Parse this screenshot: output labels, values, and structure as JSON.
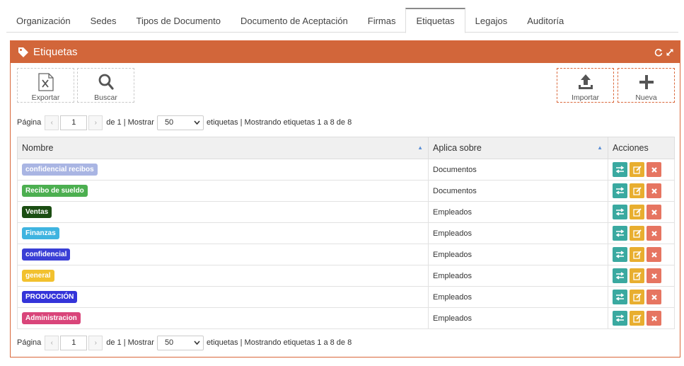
{
  "tabs": [
    {
      "label": "Organización",
      "active": false
    },
    {
      "label": "Sedes",
      "active": false
    },
    {
      "label": "Tipos de Documento",
      "active": false
    },
    {
      "label": "Documento de Aceptación",
      "active": false
    },
    {
      "label": "Firmas",
      "active": false
    },
    {
      "label": "Etiquetas",
      "active": true
    },
    {
      "label": "Legajos",
      "active": false
    },
    {
      "label": "Auditoría",
      "active": false
    }
  ],
  "panel": {
    "title": "Etiquetas",
    "title_icon": "tag-icon",
    "header_icons": [
      "refresh-icon",
      "expand-icon"
    ],
    "accent_color": "#d2663a"
  },
  "toolbar": {
    "export_label": "Exportar",
    "search_label": "Buscar",
    "import_label": "Importar",
    "new_label": "Nueva"
  },
  "pager": {
    "page_label": "Página",
    "page_value": "1",
    "of_text": "de 1 | Mostrar",
    "page_size": "50",
    "summary": "etiquetas | Mostrando etiquetas 1 a 8 de 8",
    "prev_glyph": "‹",
    "next_glyph": "›"
  },
  "table": {
    "columns": [
      "Nombre",
      "Aplica sobre",
      "Acciones"
    ],
    "rows": [
      {
        "name": "confidencial recibos",
        "color": "#a9b5e3",
        "applies": "Documentos"
      },
      {
        "name": "Recibo de sueldo",
        "color": "#4caf50",
        "applies": "Documentos"
      },
      {
        "name": "Ventas",
        "color": "#1b4d12",
        "applies": "Empleados"
      },
      {
        "name": "Finanzas",
        "color": "#3fb4e0",
        "applies": "Empleados"
      },
      {
        "name": "confidencial",
        "color": "#3a3fd6",
        "applies": "Empleados"
      },
      {
        "name": "general",
        "color": "#f2c12e",
        "applies": "Empleados"
      },
      {
        "name": "PRODUCCIÓN",
        "color": "#3434d9",
        "applies": "Empleados"
      },
      {
        "name": "Administracion",
        "color": "#d9457a",
        "applies": "Empleados"
      }
    ],
    "row_actions": [
      "transfer-icon",
      "edit-icon",
      "delete-icon"
    ]
  },
  "colors": {
    "teal": "#3aa9a0",
    "yellow": "#e8ae2f",
    "red": "#e67561"
  }
}
